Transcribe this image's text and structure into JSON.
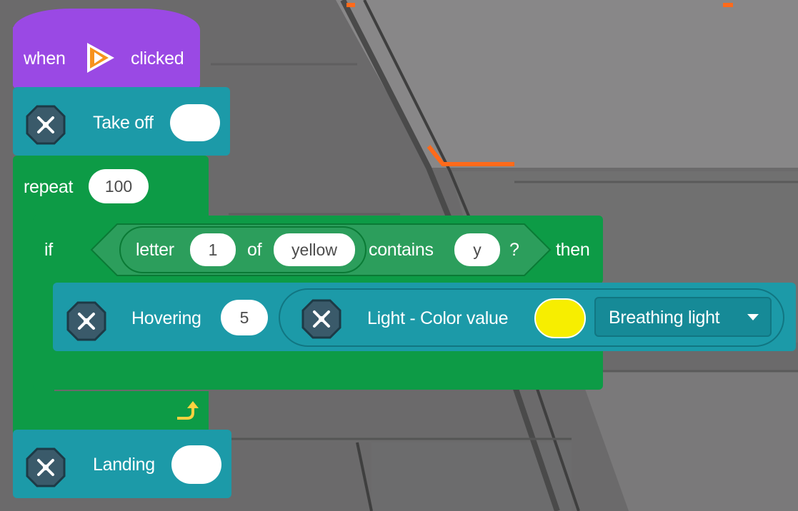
{
  "hat": {
    "when": "when",
    "clicked": "clicked",
    "icon": "play-flag-icon"
  },
  "take_off": {
    "label": "Take off",
    "value": "",
    "icon": "drone-icon"
  },
  "repeat": {
    "label": "repeat",
    "count": "100",
    "loop_icon": "loop-arrow-icon"
  },
  "if_block": {
    "if_label": "if",
    "then_label": "then",
    "condition": {
      "letter_label": "letter",
      "letter_index": "1",
      "of_label": "of",
      "word": "yellow",
      "contains_label": "contains",
      "search": "y",
      "question": "?"
    }
  },
  "hovering": {
    "label": "Hovering",
    "value": "5",
    "icon": "drone-icon"
  },
  "light": {
    "label": "Light - Color value",
    "color": "#f7ee00",
    "mode": "Breathing light",
    "icon": "drone-icon"
  },
  "landing": {
    "label": "Landing",
    "value": "",
    "icon": "drone-icon"
  },
  "colors": {
    "hat": "#9a49e4",
    "drone": "#1c9aa8",
    "control": "#0d9b46",
    "operator": "#2c9e5c"
  }
}
